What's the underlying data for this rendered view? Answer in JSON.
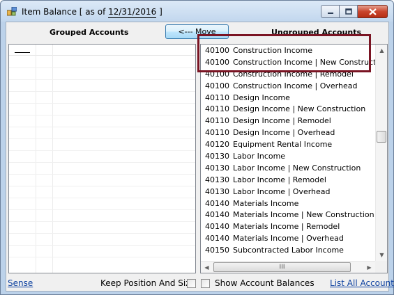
{
  "window": {
    "title_prefix": "Item Balance [ as of ",
    "title_date": "12/31/2016",
    "title_suffix": " ]"
  },
  "headers": {
    "grouped": "Grouped Accounts",
    "ungrouped": "Ungrouped Accounts"
  },
  "move_button": "<--- Move",
  "ungrouped_accounts": [
    {
      "code": "40100",
      "name": "Construction Income"
    },
    {
      "code": "40100",
      "name": "Construction Income | New Construction"
    },
    {
      "code": "40100",
      "name": "Construction Income | Remodel"
    },
    {
      "code": "40100",
      "name": "Construction Income | Overhead"
    },
    {
      "code": "40110",
      "name": "Design Income"
    },
    {
      "code": "40110",
      "name": "Design Income | New Construction"
    },
    {
      "code": "40110",
      "name": "Design Income | Remodel"
    },
    {
      "code": "40110",
      "name": "Design Income | Overhead"
    },
    {
      "code": "40120",
      "name": "Equipment Rental Income"
    },
    {
      "code": "40130",
      "name": "Labor Income"
    },
    {
      "code": "40130",
      "name": "Labor Income | New Construction"
    },
    {
      "code": "40130",
      "name": "Labor Income | Remodel"
    },
    {
      "code": "40130",
      "name": "Labor Income | Overhead"
    },
    {
      "code": "40140",
      "name": "Materials Income"
    },
    {
      "code": "40140",
      "name": "Materials Income | New Construction"
    },
    {
      "code": "40140",
      "name": "Materials Income | Remodel"
    },
    {
      "code": "40140",
      "name": "Materials Income | Overhead"
    },
    {
      "code": "40150",
      "name": "Subcontracted Labor Income"
    }
  ],
  "footer": {
    "sense_link": "Sense",
    "keep_position_label": "Keep Position And Size",
    "show_balances_label": "Show Account Balances",
    "list_all_link": "List All Accounts"
  },
  "scroll": {
    "hscroll_grip": "III"
  },
  "colors": {
    "highlight": "#7a1423",
    "link": "#0b3f9f"
  }
}
